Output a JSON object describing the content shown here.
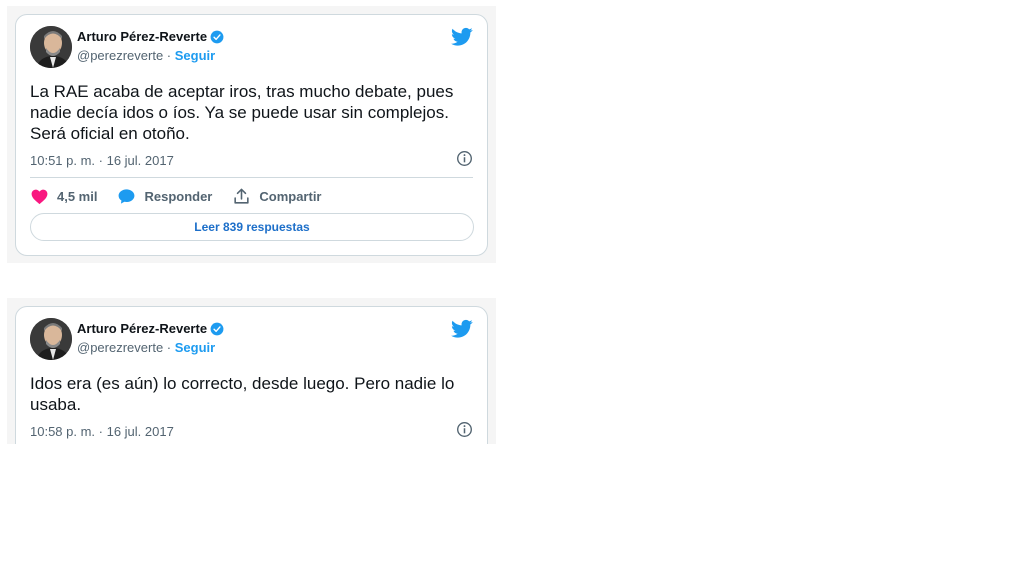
{
  "colors": {
    "brand": "#1d9bf0",
    "like": "#f91880",
    "text": "#0f1419",
    "muted": "#536471",
    "border": "#cfd9de"
  },
  "tweets": [
    {
      "author_name": "Arturo Pérez-Reverte",
      "handle": "@perezreverte",
      "separator": " · ",
      "follow_label": "Seguir",
      "text_lines": [
        "La RAE acaba de aceptar iros, tras mucho debate, pues",
        "nadie decía idos o íos. Ya se puede usar sin complejos.",
        "Será oficial en otoño."
      ],
      "timestamp": "10:51 p. m. · 16 jul. 2017",
      "likes": "4,5 mil",
      "reply_label": "Responder",
      "share_label": "Compartir",
      "read_replies_label": "Leer 839 respuestas"
    },
    {
      "author_name": "Arturo Pérez-Reverte",
      "handle": "@perezreverte",
      "separator": " · ",
      "follow_label": "Seguir",
      "text_lines": [
        "Idos era (es aún) lo correcto, desde luego. Pero nadie lo",
        "usaba."
      ],
      "timestamp": "10:58 p. m. · 16 jul. 2017"
    }
  ]
}
